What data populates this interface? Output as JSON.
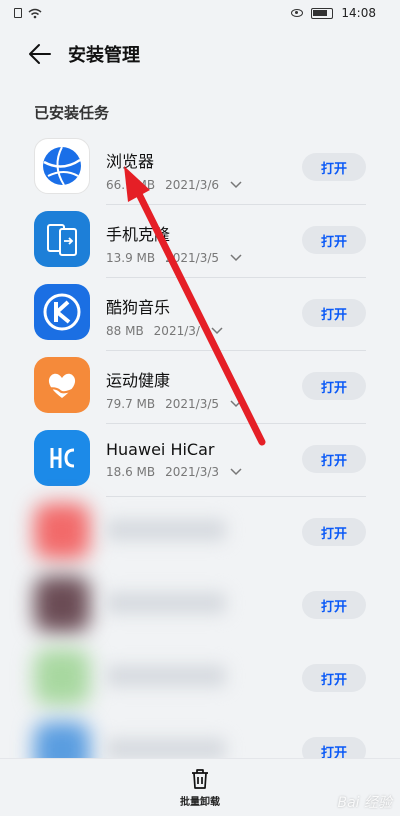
{
  "status_bar": {
    "time": "14:08"
  },
  "header": {
    "title": "安装管理"
  },
  "section": {
    "title": "已安装任务"
  },
  "apps": [
    {
      "name": "浏览器",
      "size": "66.9 MB",
      "date": "2021/3/6",
      "action": "打开",
      "icon": "browser-icon"
    },
    {
      "name": "手机克隆",
      "size": "13.9 MB",
      "date": "2021/3/5",
      "action": "打开",
      "icon": "phone-clone-icon"
    },
    {
      "name": "酷狗音乐",
      "size": "88 MB",
      "date": "2021/3/",
      "action": "打开",
      "icon": "kugou-icon"
    },
    {
      "name": "运动健康",
      "size": "79.7 MB",
      "date": "2021/3/5",
      "action": "打开",
      "icon": "health-icon"
    },
    {
      "name": "Huawei HiCar",
      "size": "18.6 MB",
      "date": "2021/3/3",
      "action": "打开",
      "icon": "hicar-icon"
    }
  ],
  "blurred_apps": [
    {
      "action": "打开",
      "color": "#f26a6a"
    },
    {
      "action": "打开",
      "color": "#6b4c55"
    },
    {
      "action": "打开",
      "color": "#a8d8a0"
    },
    {
      "action": "打开",
      "color": "#5a9de0"
    }
  ],
  "bottom_bar": {
    "uninstall_label": "批量卸载"
  },
  "colors": {
    "accent": "#0a59f7",
    "arrow": "#e51f26"
  }
}
